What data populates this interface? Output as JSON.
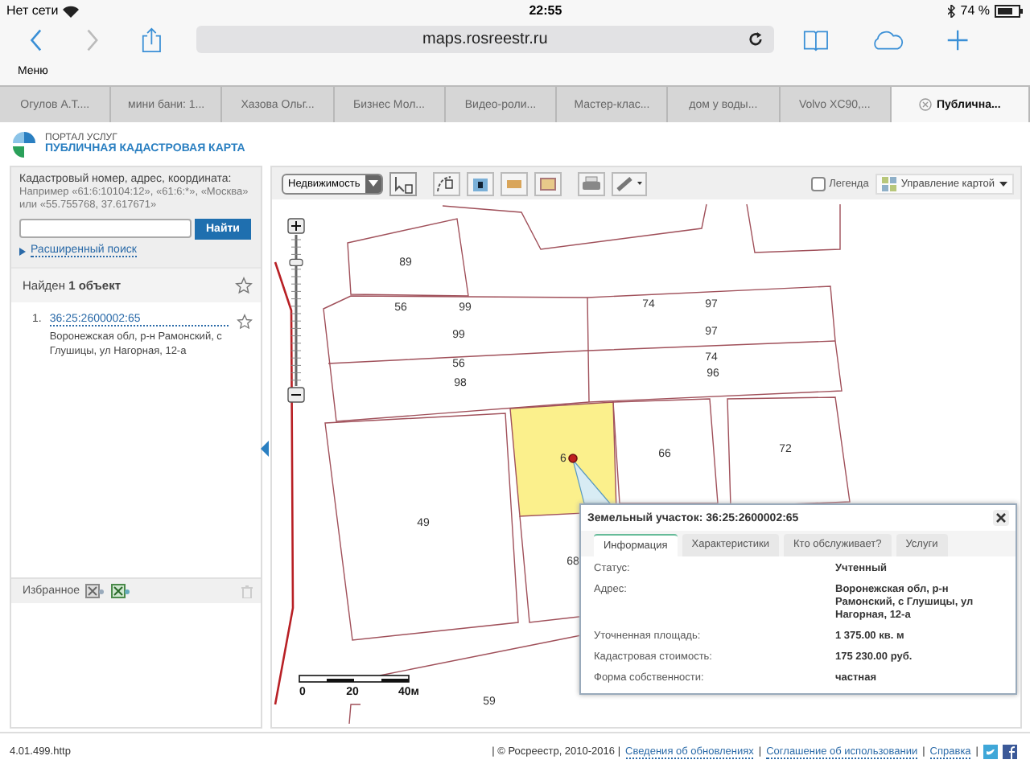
{
  "status_bar": {
    "carrier": "Нет сети",
    "time": "22:55",
    "battery": "74 %"
  },
  "browser": {
    "url": "maps.rosreestr.ru",
    "menu_label": "Меню",
    "tabs": [
      {
        "title": "Огулов А.Т....",
        "selected": false
      },
      {
        "title": "мини бани: 1...",
        "selected": false
      },
      {
        "title": "Хазова Ольг...",
        "selected": false
      },
      {
        "title": "Бизнес Мол...",
        "selected": false
      },
      {
        "title": "Видео-роли...",
        "selected": false
      },
      {
        "title": "Мастер-клас...",
        "selected": false
      },
      {
        "title": "дом у воды...",
        "selected": false
      },
      {
        "title": "Volvo XC90,...",
        "selected": false
      },
      {
        "title": "Публична...",
        "selected": true
      }
    ]
  },
  "portal": {
    "subtitle": "ПОРТАЛ УСЛУГ",
    "title": "ПУБЛИЧНАЯ КАДАСТРОВАЯ КАРТА"
  },
  "search": {
    "label": "Кадастровый номер, адрес, координата:",
    "hint": "Например «61:6:10104:12», «61:6:*», «Москва» или «55.755768, 37.617671»",
    "button": "Найти",
    "advanced_link": "Расширенный поиск"
  },
  "results": {
    "header": "Найден **1 объект**",
    "items": [
      {
        "number": "1.",
        "cadastral_number": "36:25:2600002:65",
        "address": "Воронежская обл, р-н Рамонский, с Глушицы, ул Нагорная, 12-а"
      }
    ]
  },
  "favorites": {
    "title": "Избранное"
  },
  "map_toolbar": {
    "layer_select": "Недвижимость",
    "legend": {
      "label": "Легенда",
      "checked": false
    },
    "map_control": "Управление картой"
  },
  "map": {
    "zoom_slider": {
      "level": 0.85
    },
    "parcel_labels": [
      "89",
      "56",
      "99",
      "99",
      "56",
      "98",
      "74",
      "97",
      "97",
      "74",
      "96",
      "6",
      "66",
      "72",
      "49",
      "68",
      "59"
    ],
    "scale_labels": [
      "0",
      "20",
      "40м"
    ]
  },
  "popup": {
    "title": "Земельный участок: 36:25:2600002:65",
    "tabs": [
      {
        "label": "Информация",
        "selected": true
      },
      {
        "label": "Характеристики",
        "selected": false
      },
      {
        "label": "Кто обслуживает?",
        "selected": false
      },
      {
        "label": "Услуги",
        "selected": false
      }
    ],
    "rows": [
      {
        "label": "Статус:",
        "value": "Учтенный"
      },
      {
        "label": "Адрес:",
        "value": "Воронежская обл, р-н Рамонский, с Глушицы, ул Нагорная, 12-а"
      },
      {
        "label": "Уточненная площадь:",
        "value": "1 375.00 кв. м"
      },
      {
        "label": "Кадастровая стоимость:",
        "value": "175 230.00 руб."
      },
      {
        "label": "Форма собственности:",
        "value": "частная"
      }
    ]
  },
  "footer": {
    "version": "4.01.499.http",
    "copyright": "| © Росреестр, 2010-2016 |",
    "separator": "|",
    "links": [
      "Сведения об обновлениях",
      "Соглашение об использовании",
      "Справка"
    ]
  }
}
